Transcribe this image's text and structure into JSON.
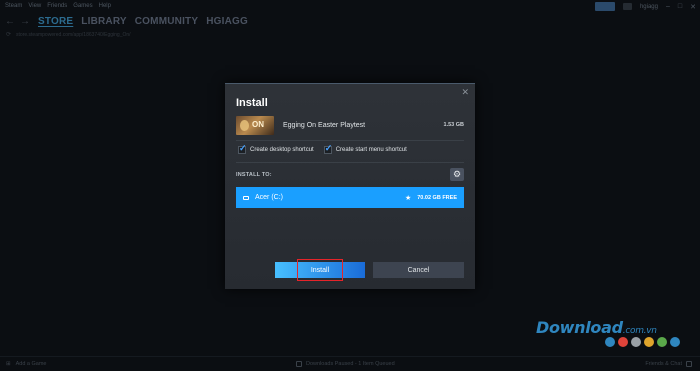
{
  "menubar": {
    "items": [
      "Steam",
      "View",
      "Friends",
      "Games",
      "Help"
    ],
    "username": "hgiagg"
  },
  "nav": {
    "tabs": [
      "STORE",
      "LIBRARY",
      "COMMUNITY",
      "HGIAGG"
    ],
    "active_tab": "STORE"
  },
  "url": "store.steampowered.com/app/1863740/Egging_On/",
  "dialog": {
    "title": "Install",
    "game_name": "Egging On Easter Playtest",
    "game_size": "1.53 GB",
    "thumb_text": "ON",
    "checkbox_desktop": "Create desktop shortcut",
    "checkbox_startmenu": "Create start menu shortcut",
    "desktop_checked": true,
    "startmenu_checked": true,
    "install_to_label": "INSTALL TO:",
    "drive_name": "Acer (C:)",
    "drive_free": "70.02 GB FREE",
    "install_button": "Install",
    "cancel_button": "Cancel",
    "close_glyph": "✕"
  },
  "bottombar": {
    "add_game": "Add a Game",
    "downloads": "Downloads Paused - 1 Item Queued",
    "friends": "Friends & Chat"
  },
  "watermark": {
    "text": "Download",
    "ext": ".com.vn",
    "dot_colors": [
      "#2f86bf",
      "#e0443a",
      "#9aa0a6",
      "#e0a52c",
      "#5aa84a",
      "#2f86bf"
    ]
  },
  "colors": {
    "accent": "#1a9fff",
    "highlight": "#e5242a"
  }
}
